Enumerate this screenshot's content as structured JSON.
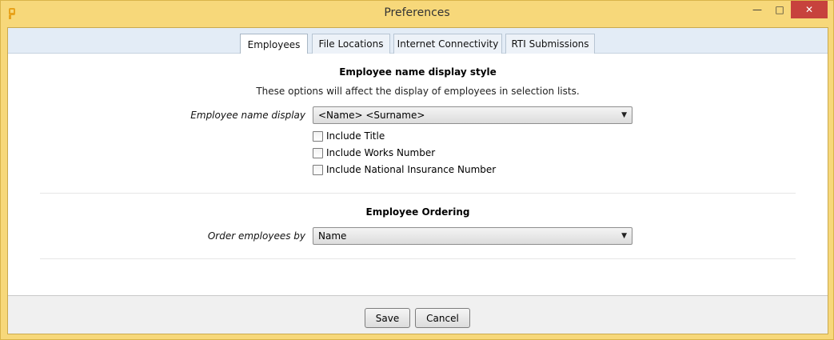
{
  "window": {
    "title": "Preferences",
    "minimize": "—",
    "maximize": "□",
    "close": "✕"
  },
  "tabs": [
    {
      "label": "Employees",
      "active": true
    },
    {
      "label": "File Locations",
      "active": false
    },
    {
      "label": "Internet Connectivity",
      "active": false
    },
    {
      "label": "RTI Submissions",
      "active": false
    }
  ],
  "display_section": {
    "title": "Employee name display style",
    "description": "These options will affect the display of employees in selection lists.",
    "name_display_label": "Employee name display",
    "name_display_value": "<Name> <Surname>",
    "checkboxes": [
      {
        "label": "Include Title",
        "checked": false
      },
      {
        "label": "Include Works Number",
        "checked": false
      },
      {
        "label": "Include National Insurance Number",
        "checked": false
      }
    ]
  },
  "ordering_section": {
    "title": "Employee Ordering",
    "order_label": "Order employees by",
    "order_value": "Name"
  },
  "footer": {
    "save_label": "Save",
    "cancel_label": "Cancel"
  }
}
